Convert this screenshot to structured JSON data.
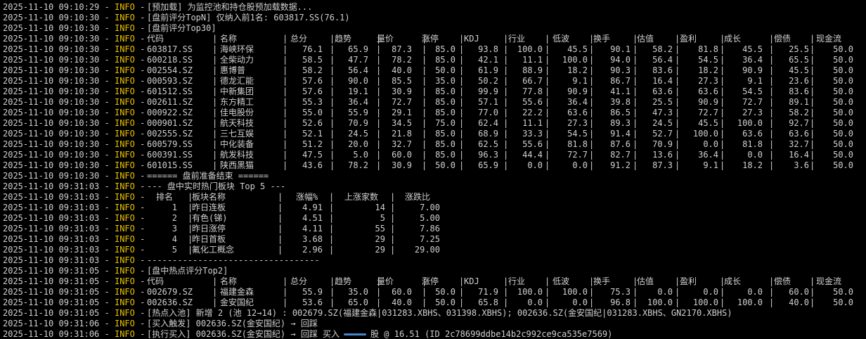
{
  "log": [
    {
      "ts": "2025-11-10 09:10:29",
      "lvl": "INFO",
      "msg": "[预加载] 为监控池和持仓股预加载数据..."
    },
    {
      "ts": "2025-11-10 09:10:30",
      "lvl": "INFO",
      "msg": "[盘前评分TopN] 仅纳入前1名: 603817.SS(76.1)"
    },
    {
      "ts": "2025-11-10 09:10:30",
      "lvl": "INFO",
      "msg": "[盘前评分Top30]"
    }
  ],
  "premarket_table": {
    "ts": "2025-11-10 09:10:30",
    "lvl": "INFO",
    "headers": [
      "代码",
      "名称",
      "总分",
      "趋势",
      "量价",
      "涨停",
      "KDJ",
      "行业",
      "低波",
      "换手",
      "估值",
      "盈利",
      "成长",
      "偿债",
      "现金流"
    ],
    "rows": [
      [
        "603817.SS",
        "海峡环保",
        "76.1",
        "65.9",
        "87.3",
        "85.0",
        "93.8",
        "100.0",
        "45.5",
        "90.1",
        "58.2",
        "81.8",
        "45.5",
        "25.5",
        "50.0"
      ],
      [
        "600218.SS",
        "全柴动力",
        "58.5",
        "47.7",
        "78.2",
        "85.0",
        "42.1",
        "11.1",
        "100.0",
        "94.0",
        "56.4",
        "54.5",
        "36.4",
        "65.5",
        "50.0"
      ],
      [
        "002554.SZ",
        "惠博普",
        "58.2",
        "56.4",
        "40.0",
        "50.0",
        "61.9",
        "88.9",
        "18.2",
        "90.3",
        "83.6",
        "18.2",
        "90.9",
        "45.5",
        "50.0"
      ],
      [
        "000593.SZ",
        "德龙汇能",
        "57.6",
        "90.0",
        "85.5",
        "35.0",
        "50.2",
        "66.7",
        "9.1",
        "86.7",
        "16.4",
        "27.3",
        "9.1",
        "23.6",
        "50.0"
      ],
      [
        "601512.SS",
        "中新集团",
        "57.6",
        "19.1",
        "30.9",
        "85.0",
        "99.9",
        "77.8",
        "90.9",
        "41.1",
        "63.6",
        "63.6",
        "54.5",
        "83.6",
        "50.0"
      ],
      [
        "002611.SZ",
        "东方精工",
        "55.3",
        "36.4",
        "72.7",
        "85.0",
        "57.1",
        "55.6",
        "36.4",
        "39.8",
        "25.5",
        "90.9",
        "72.7",
        "89.1",
        "50.0"
      ],
      [
        "000922.SZ",
        "佳电股份",
        "55.0",
        "55.9",
        "29.1",
        "85.0",
        "77.0",
        "22.2",
        "63.6",
        "86.5",
        "47.3",
        "72.7",
        "27.3",
        "58.2",
        "50.0"
      ],
      [
        "000901.SZ",
        "航天科技",
        "52.6",
        "70.9",
        "34.5",
        "75.0",
        "62.4",
        "11.1",
        "27.3",
        "89.3",
        "24.5",
        "45.5",
        "100.0",
        "92.7",
        "50.0"
      ],
      [
        "002555.SZ",
        "三七互娱",
        "52.1",
        "24.5",
        "21.8",
        "85.0",
        "68.9",
        "33.3",
        "54.5",
        "91.4",
        "52.7",
        "100.0",
        "63.6",
        "63.6",
        "50.0"
      ],
      [
        "600579.SS",
        "中化装备",
        "51.2",
        "20.0",
        "32.7",
        "85.0",
        "62.5",
        "55.6",
        "81.8",
        "87.6",
        "70.9",
        "0.0",
        "81.8",
        "32.7",
        "50.0"
      ],
      [
        "600391.SS",
        "航发科技",
        "47.5",
        "5.0",
        "60.0",
        "85.0",
        "96.3",
        "44.4",
        "72.7",
        "82.7",
        "13.6",
        "36.4",
        "0.0",
        "16.4",
        "50.0"
      ],
      [
        "601015.SS",
        "陕西黑猫",
        "43.6",
        "78.2",
        "30.9",
        "50.0",
        "65.9",
        "0.0",
        "0.0",
        "91.2",
        "87.3",
        "9.1",
        "18.2",
        "3.6",
        "50.0"
      ]
    ]
  },
  "log2": [
    {
      "ts": "2025-11-10 09:10:30",
      "lvl": "INFO",
      "msg": "====== 盘前准备结束 ======"
    },
    {
      "ts": "2025-11-10 09:31:03",
      "lvl": "INFO",
      "msg": "--- 盘中实时热门板块 Top 5 ---"
    }
  ],
  "sector_table": {
    "ts": "2025-11-10 09:31:03",
    "lvl": "INFO",
    "headers": [
      "排名",
      "板块名称",
      "涨幅%",
      "上涨家数",
      "涨跌比"
    ],
    "rows": [
      [
        "1",
        "昨日连板",
        "4.91",
        "14",
        "7.00"
      ],
      [
        "2",
        "有色(锑)",
        "4.51",
        "5",
        "5.00"
      ],
      [
        "3",
        "昨日涨停",
        "4.11",
        "55",
        "7.86"
      ],
      [
        "4",
        "昨日首板",
        "3.68",
        "29",
        "7.25"
      ],
      [
        "5",
        "氟化工概念",
        "2.96",
        "29",
        "29.00"
      ]
    ]
  },
  "log3": [
    {
      "ts": "2025-11-10 09:31:03",
      "lvl": "INFO",
      "msg": "----------------------------------"
    },
    {
      "ts": "2025-11-10 09:31:05",
      "lvl": "INFO",
      "msg": "[盘中热点评分Top2]"
    }
  ],
  "intraday_table": {
    "ts": "2025-11-10 09:31:05",
    "lvl": "INFO",
    "rows": [
      [
        "002679.SZ",
        "福建金森",
        "55.9",
        "35.0",
        "60.0",
        "50.0",
        "71.9",
        "100.0",
        "100.0",
        "75.3",
        "0.0",
        "0.0",
        "0.0",
        "60.0",
        "50.0"
      ],
      [
        "002636.SZ",
        "金安国纪",
        "53.6",
        "65.0",
        "40.0",
        "50.0",
        "65.8",
        "0.0",
        "0.0",
        "96.8",
        "100.0",
        "100.0",
        "100.0",
        "40.0",
        "50.0"
      ]
    ]
  },
  "log4": [
    {
      "ts": "2025-11-10 09:31:05",
      "lvl": "INFO",
      "msg": "[热点入池] 新增 2 (池 12→14) : 002679.SZ(福建金森|031283.XBHS、031398.XBHS); 002636.SZ(金安国纪|031283.XBHS、GN2170.XBHS)"
    },
    {
      "ts": "2025-11-10 09:31:06",
      "lvl": "INFO",
      "msg": "[买入触发] 002636.SZ(金安国纪) → 回踩"
    },
    {
      "ts": "2025-11-10 09:31:06",
      "lvl": "INFO",
      "msg": "[执行买入] 002636.SZ(金安国纪) → 回踩 买入",
      "tail": "股 @ 16.51 (ID 2c78699ddbe14b2c992ce9ca535e7569)"
    }
  ],
  "colors": {
    "background": "#000000",
    "text": "#d0d0d0",
    "level": "#e8c000"
  }
}
